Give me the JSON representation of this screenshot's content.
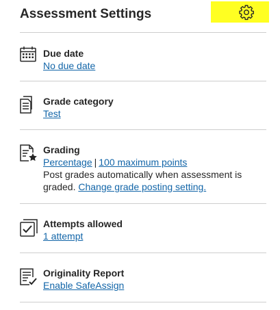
{
  "header": {
    "title": "Assessment Settings",
    "settings_icon": "gear-icon",
    "highlight_color": "#ffff22"
  },
  "accent_link_color": "#1265a8",
  "sections": {
    "due_date": {
      "icon": "calendar-icon",
      "label": "Due date",
      "link": "No due date"
    },
    "grade_category": {
      "icon": "document-icon",
      "label": "Grade category",
      "link": "Test"
    },
    "grading": {
      "icon": "grading-star-icon",
      "label": "Grading",
      "schema_link": "Percentage",
      "separator": "|",
      "points_link": "100 maximum points",
      "posting_text": "Post grades automatically when assessment is graded.",
      "posting_link": "Change grade posting setting."
    },
    "attempts": {
      "icon": "attempts-check-icon",
      "label": "Attempts allowed",
      "link": "1 attempt"
    },
    "originality": {
      "icon": "originality-report-icon",
      "label": "Originality Report",
      "link": "Enable SafeAssign"
    }
  }
}
